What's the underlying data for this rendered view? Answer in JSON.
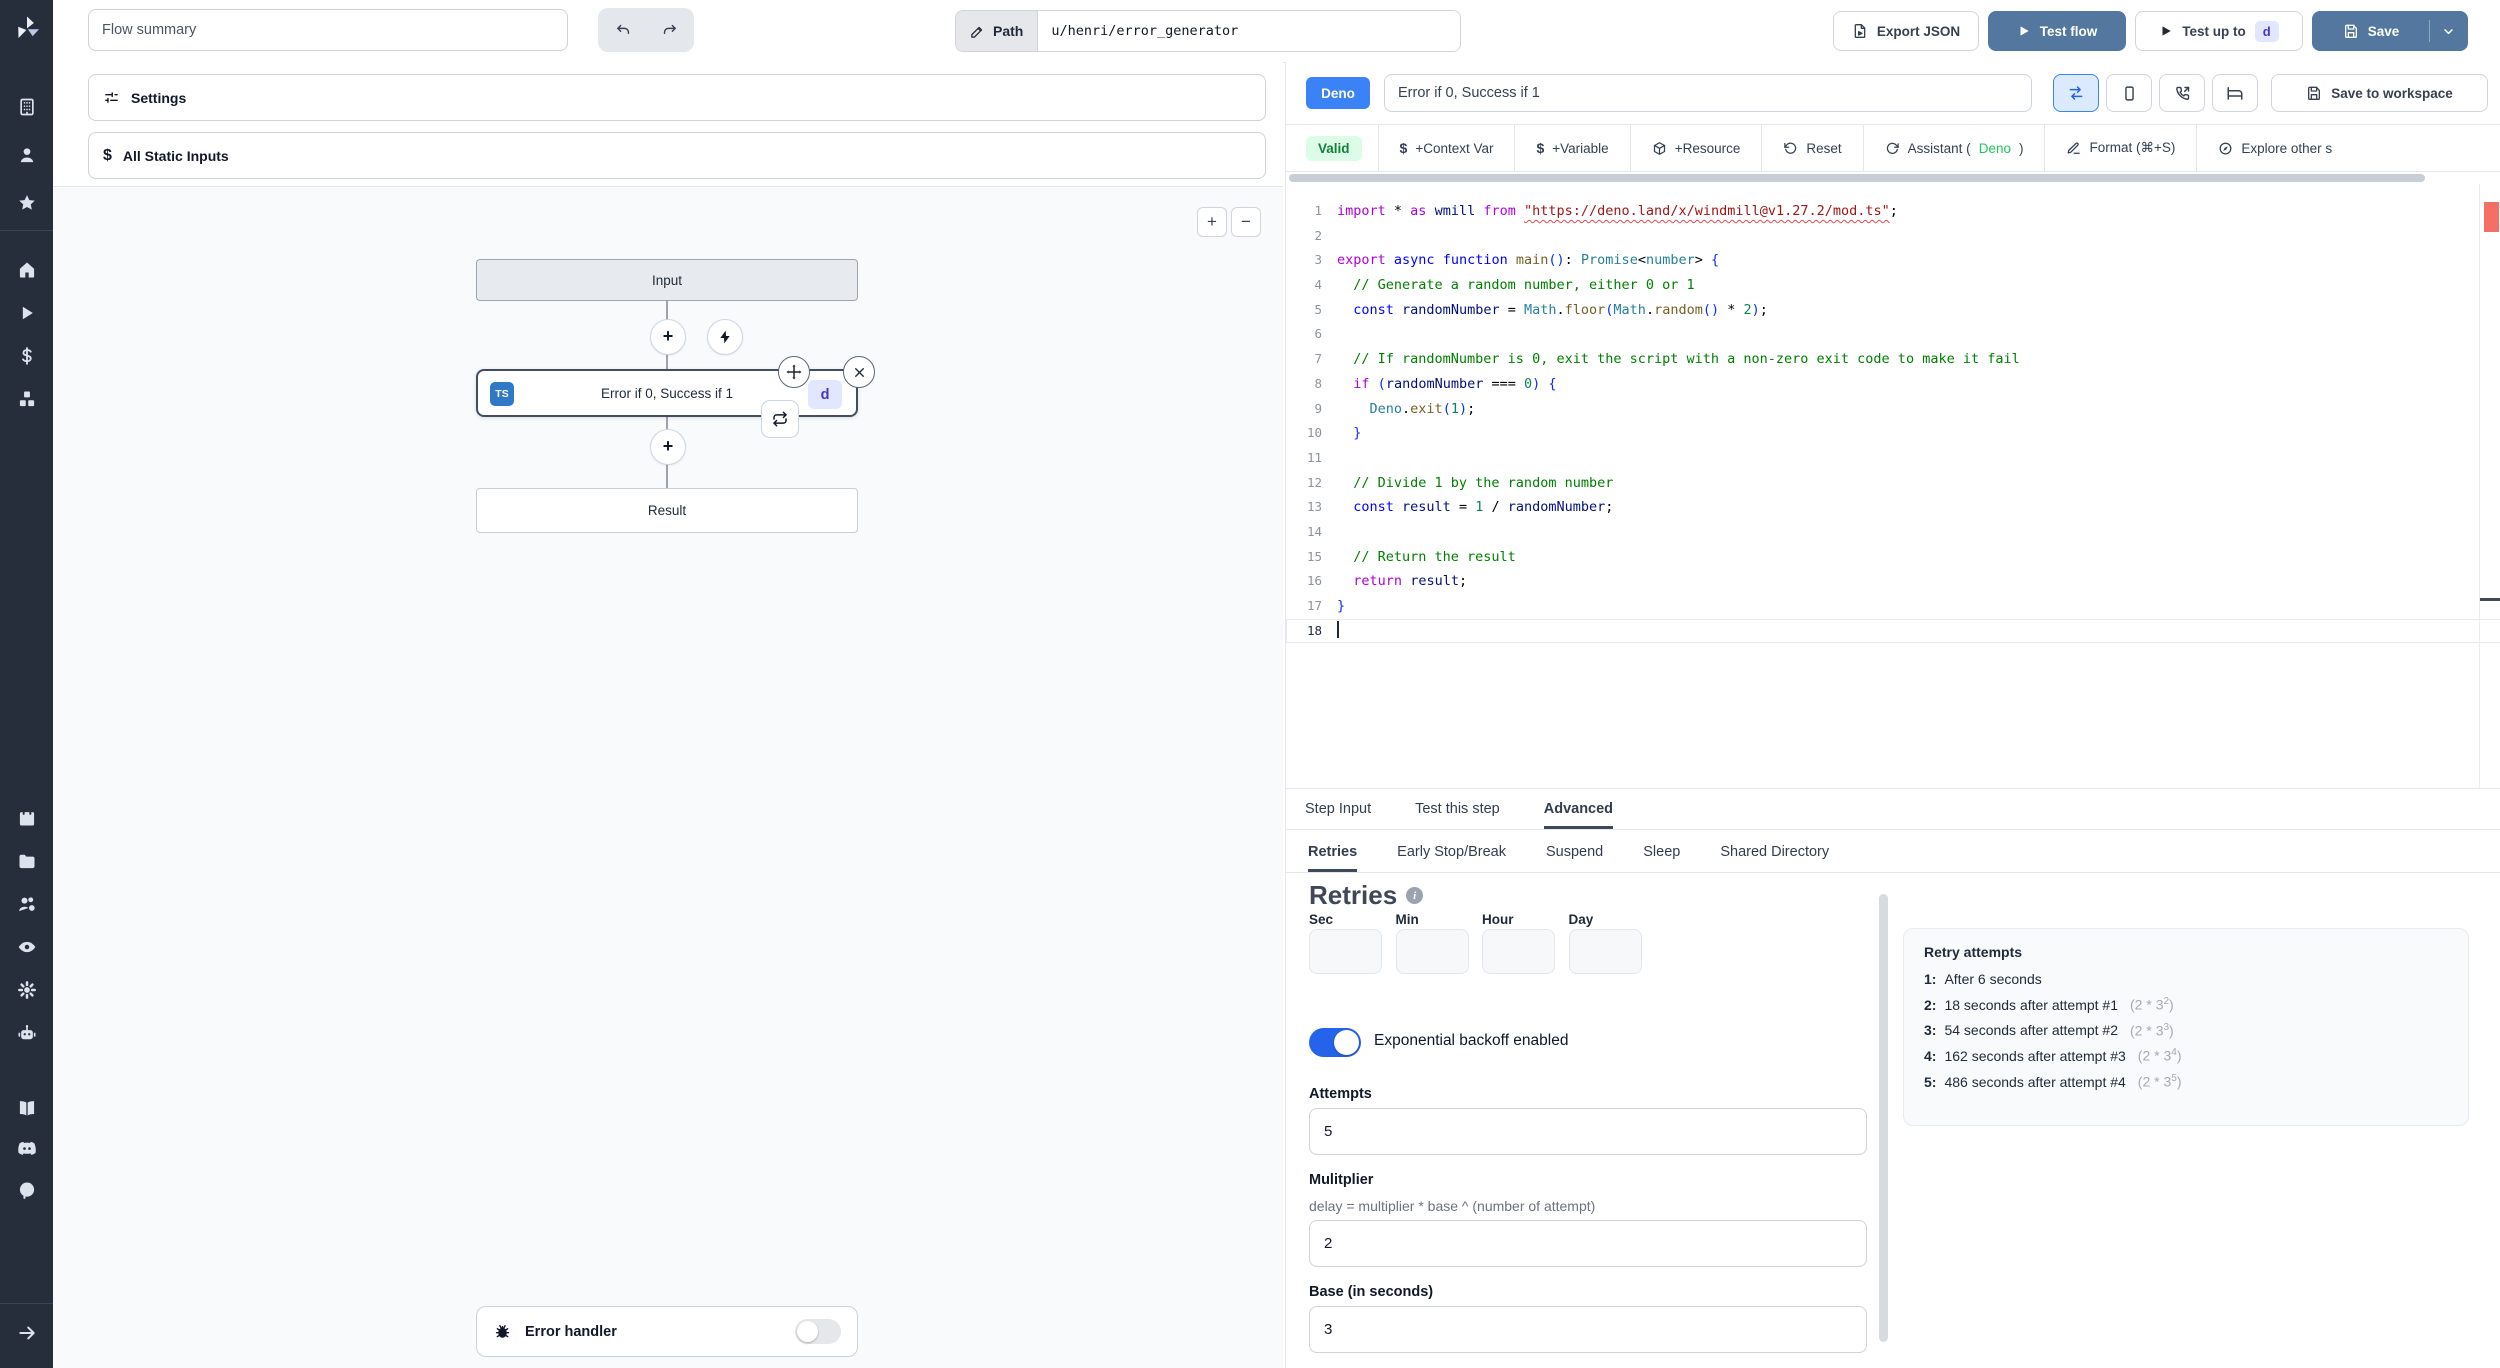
{
  "colors": {
    "accent_blue": "#3b82f6",
    "button_blue": "#53779f",
    "valid_green_bg": "#dcfce7",
    "valid_green_text": "#15803d",
    "assistant_green": "#22c55e",
    "badge_indigo_bg": "#e0e7ff",
    "badge_indigo_text": "#4338ca",
    "toggle_on_blue": "#2563eb",
    "ts_badge_blue": "#3178c6",
    "sidebar_bg": "#272e3b"
  },
  "topbar": {
    "flow_summary_placeholder": "Flow summary",
    "path_label": "Path",
    "path_value": "u/henri/error_generator",
    "export_json_label": "Export JSON",
    "test_flow_label": "Test flow",
    "test_up_to_label": "Test up to",
    "test_up_to_badge": "d",
    "save_label": "Save"
  },
  "sidebar": {
    "groups": [
      [
        "building",
        "user",
        "star"
      ],
      [
        "home",
        "play",
        "dollar",
        "boxes"
      ],
      [
        "calendar",
        "folder",
        "users",
        "eye",
        "gear",
        "bot"
      ],
      [
        "book",
        "discord",
        "github"
      ],
      [
        "arrow-right"
      ]
    ]
  },
  "left_panel": {
    "settings_label": "Settings",
    "static_inputs_label": "All Static Inputs",
    "zoom_in": "+",
    "zoom_out": "−",
    "flow": {
      "input_node": "Input",
      "step_node": "Error if 0, Success if 1",
      "step_lang_badge": "TS",
      "step_id_badge": "d",
      "result_node": "Result"
    },
    "error_handler_label": "Error handler"
  },
  "script_panel": {
    "lang_badge": "Deno",
    "name_value": "Error if 0, Success if 1",
    "save_to_workspace_label": "Save to workspace",
    "valid_badge": "Valid",
    "toolbar_items": [
      {
        "icon": "dollar-text",
        "label": "+Context Var"
      },
      {
        "icon": "dollar-text",
        "label": "+Variable"
      },
      {
        "icon": "package",
        "label": "+Resource"
      },
      {
        "icon": "rotate-ccw",
        "label": "Reset"
      },
      {
        "icon": "refresh-cw",
        "label": "Assistant (",
        "accent": "Deno",
        "suffix": ")"
      },
      {
        "icon": "pen",
        "label": "Format (⌘+S)"
      },
      {
        "icon": "compass",
        "label": "Explore other s"
      }
    ]
  },
  "code": {
    "lines": [
      {
        "n": "1",
        "tokens": [
          [
            "kw",
            "import"
          ],
          [
            "pl",
            " * "
          ],
          [
            "kw",
            "as"
          ],
          [
            "pl",
            " "
          ],
          [
            "vr",
            "wmill"
          ],
          [
            "pl",
            " "
          ],
          [
            "kw",
            "from"
          ],
          [
            "pl",
            " "
          ],
          [
            "sq",
            "\"https://deno.land/x/windmill@v1.27.2/mod.ts\""
          ],
          [
            "pl",
            ";"
          ]
        ]
      },
      {
        "n": "2",
        "tokens": []
      },
      {
        "n": "3",
        "tokens": [
          [
            "kw",
            "export"
          ],
          [
            "pl",
            " "
          ],
          [
            "kw2",
            "async"
          ],
          [
            "pl",
            " "
          ],
          [
            "kw2",
            "function"
          ],
          [
            "pl",
            " "
          ],
          [
            "fn",
            "main"
          ],
          [
            "br",
            "()"
          ],
          [
            "pl",
            ": "
          ],
          [
            "ty",
            "Promise"
          ],
          [
            "pl",
            "<"
          ],
          [
            "ty",
            "number"
          ],
          [
            "pl",
            "> "
          ],
          [
            "br",
            "{"
          ]
        ]
      },
      {
        "n": "4",
        "tokens": [
          [
            "cm",
            "  // Generate a random number, either 0 or 1"
          ]
        ]
      },
      {
        "n": "5",
        "tokens": [
          [
            "pl",
            "  "
          ],
          [
            "kw2",
            "const"
          ],
          [
            "pl",
            " "
          ],
          [
            "vr",
            "randomNumber"
          ],
          [
            "pl",
            " = "
          ],
          [
            "ty",
            "Math"
          ],
          [
            "pl",
            "."
          ],
          [
            "fn",
            "floor"
          ],
          [
            "br",
            "("
          ],
          [
            "ty",
            "Math"
          ],
          [
            "pl",
            "."
          ],
          [
            "fn",
            "random"
          ],
          [
            "br",
            "()"
          ],
          [
            "pl",
            " * "
          ],
          [
            "nm",
            "2"
          ],
          [
            "br",
            ")"
          ],
          [
            "pl",
            ";"
          ]
        ]
      },
      {
        "n": "6",
        "tokens": []
      },
      {
        "n": "7",
        "tokens": [
          [
            "cm",
            "  // If randomNumber is 0, exit the script with a non-zero exit code to make it fail"
          ]
        ]
      },
      {
        "n": "8",
        "tokens": [
          [
            "pl",
            "  "
          ],
          [
            "kw",
            "if"
          ],
          [
            "pl",
            " "
          ],
          [
            "br",
            "("
          ],
          [
            "vr",
            "randomNumber"
          ],
          [
            "pl",
            " === "
          ],
          [
            "nm",
            "0"
          ],
          [
            "br",
            ")"
          ],
          [
            "pl",
            " "
          ],
          [
            "br",
            "{"
          ]
        ]
      },
      {
        "n": "9",
        "tokens": [
          [
            "pl",
            "    "
          ],
          [
            "ty",
            "Deno"
          ],
          [
            "pl",
            "."
          ],
          [
            "fn",
            "exit"
          ],
          [
            "br",
            "("
          ],
          [
            "nm",
            "1"
          ],
          [
            "br",
            ")"
          ],
          [
            "pl",
            ";"
          ]
        ]
      },
      {
        "n": "10",
        "tokens": [
          [
            "pl",
            "  "
          ],
          [
            "br",
            "}"
          ]
        ]
      },
      {
        "n": "11",
        "tokens": []
      },
      {
        "n": "12",
        "tokens": [
          [
            "cm",
            "  // Divide 1 by the random number"
          ]
        ]
      },
      {
        "n": "13",
        "tokens": [
          [
            "pl",
            "  "
          ],
          [
            "kw2",
            "const"
          ],
          [
            "pl",
            " "
          ],
          [
            "vr",
            "result"
          ],
          [
            "pl",
            " = "
          ],
          [
            "nm",
            "1"
          ],
          [
            "pl",
            " / "
          ],
          [
            "vr",
            "randomNumber"
          ],
          [
            "pl",
            ";"
          ]
        ]
      },
      {
        "n": "14",
        "tokens": []
      },
      {
        "n": "15",
        "tokens": [
          [
            "cm",
            "  // Return the result"
          ]
        ]
      },
      {
        "n": "16",
        "tokens": [
          [
            "pl",
            "  "
          ],
          [
            "kw",
            "return"
          ],
          [
            "pl",
            " "
          ],
          [
            "vr",
            "result"
          ],
          [
            "pl",
            ";"
          ]
        ]
      },
      {
        "n": "17",
        "tokens": [
          [
            "br",
            "}"
          ]
        ]
      },
      {
        "n": "18",
        "tokens": [],
        "current": true
      }
    ]
  },
  "tabs": {
    "main": [
      "Step Input",
      "Test this step",
      "Advanced"
    ],
    "main_active": "Advanced",
    "sub": [
      "Retries",
      "Early Stop/Break",
      "Suspend",
      "Sleep",
      "Shared Directory"
    ],
    "sub_active": "Retries"
  },
  "retries": {
    "title": "Retries",
    "time_labels": [
      "Sec",
      "Min",
      "Hour",
      "Day"
    ],
    "toggle_label": "Exponential backoff enabled",
    "attempts_label": "Attempts",
    "attempts_value": "5",
    "multiplier_label": "Mulitplier",
    "multiplier_help": "delay = multiplier * base ^ (number of attempt)",
    "multiplier_value": "2",
    "base_label": "Base (in seconds)",
    "base_value": "3"
  },
  "retry_preview": {
    "title": "Retry attempts",
    "items": [
      {
        "index": "1:",
        "text": "After 6 seconds",
        "formula": "",
        "exp": ""
      },
      {
        "index": "2:",
        "text": "18 seconds after attempt #1",
        "formula": "(2 * 3",
        "exp": "2"
      },
      {
        "index": "3:",
        "text": "54 seconds after attempt #2",
        "formula": "(2 * 3",
        "exp": "3"
      },
      {
        "index": "4:",
        "text": "162 seconds after attempt #3",
        "formula": "(2 * 3",
        "exp": "4"
      },
      {
        "index": "5:",
        "text": "486 seconds after attempt #4",
        "formula": "(2 * 3",
        "exp": "5"
      }
    ]
  }
}
